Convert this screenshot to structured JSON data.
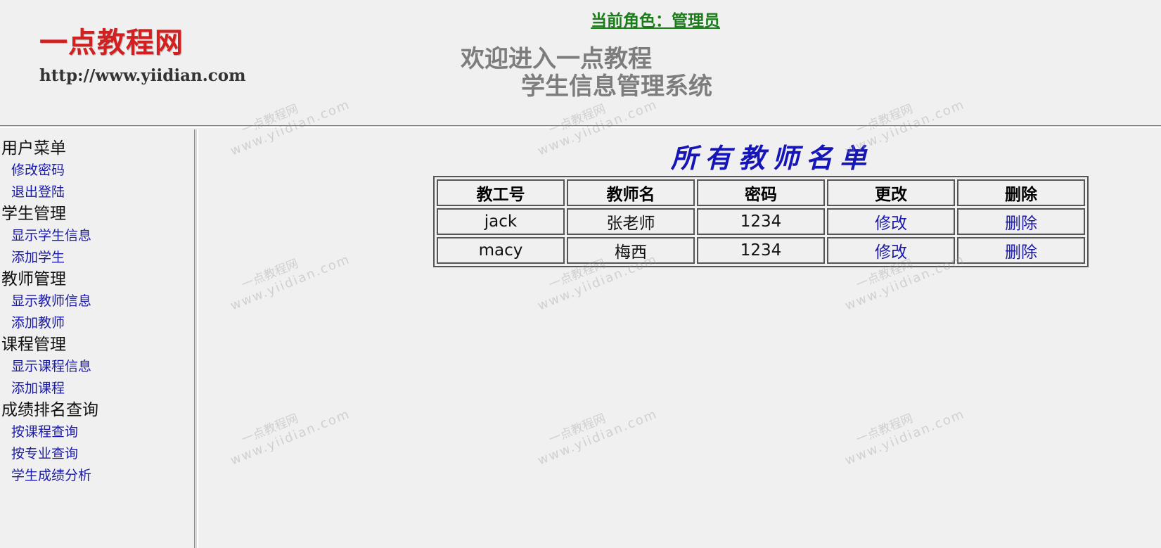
{
  "header": {
    "logo_title": "一点教程网",
    "logo_url": "http://www.yiidian.com",
    "current_role": "当前角色：管理员",
    "welcome_line1": "欢迎进入一点教程",
    "welcome_line2": "学生信息管理系统"
  },
  "sidebar": {
    "groups": [
      {
        "heading": "用户菜单",
        "links": [
          "修改密码",
          "退出登陆"
        ]
      },
      {
        "heading": "学生管理",
        "links": [
          "显示学生信息",
          "添加学生"
        ]
      },
      {
        "heading": "教师管理",
        "links": [
          "显示教师信息",
          "添加教师"
        ]
      },
      {
        "heading": "课程管理",
        "links": [
          "显示课程信息",
          "添加课程"
        ]
      },
      {
        "heading": "成绩排名查询",
        "links": [
          "按课程查询",
          "按专业查询",
          "学生成绩分析"
        ]
      }
    ]
  },
  "main": {
    "title": "所有教师名单",
    "table": {
      "headers": [
        "教工号",
        "教师名",
        "密码",
        "更改",
        "删除"
      ],
      "rows": [
        {
          "id": "jack",
          "name": "张老师",
          "password": "1234",
          "edit": "修改",
          "delete": "删除"
        },
        {
          "id": "macy",
          "name": "梅西",
          "password": "1234",
          "edit": "修改",
          "delete": "删除"
        }
      ]
    }
  },
  "watermark": {
    "name": "一点教程网",
    "url": "www.yiidian.com"
  },
  "colors": {
    "background": "#f0f0f0",
    "logo_red": "#d21f1f",
    "role_green": "#1a7d1a",
    "link_blue": "#1a1aa6",
    "title_blue": "#1515b8",
    "welcome_gray": "#7d7d7d"
  }
}
